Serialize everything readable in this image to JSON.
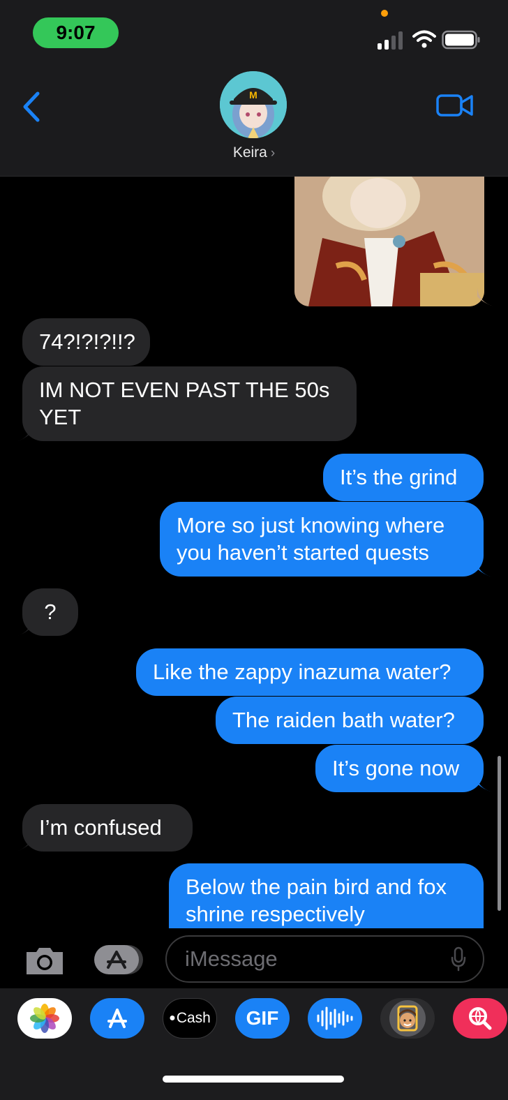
{
  "status": {
    "time": "9:07"
  },
  "header": {
    "contact_name": "Keira",
    "chevron": "›"
  },
  "messages": [
    {
      "side": "in",
      "text": "74?!?!?!!?"
    },
    {
      "side": "in",
      "text": "IM NOT EVEN PAST THE 50s YET"
    },
    {
      "side": "out",
      "text": "It’s the grind"
    },
    {
      "side": "out",
      "text": "More so just knowing where you haven’t started quests"
    },
    {
      "side": "in",
      "text": "?"
    },
    {
      "side": "out",
      "text": "Like the zappy inazuma water?"
    },
    {
      "side": "out",
      "text": "The raiden bath water?"
    },
    {
      "side": "out",
      "text": "It’s gone now"
    },
    {
      "side": "in",
      "text": "I’m confused"
    },
    {
      "side": "out",
      "text": "Below the pain bird and fox shrine respectively"
    }
  ],
  "input": {
    "placeholder": "iMessage"
  },
  "drawer": {
    "apps": [
      "photos-icon",
      "app-store-icon",
      "cash-icon",
      "gif-icon",
      "audio-icon",
      "memoji-icon",
      "search-web-icon"
    ],
    "cash_label": "Cash",
    "gif_label": "GIF"
  }
}
